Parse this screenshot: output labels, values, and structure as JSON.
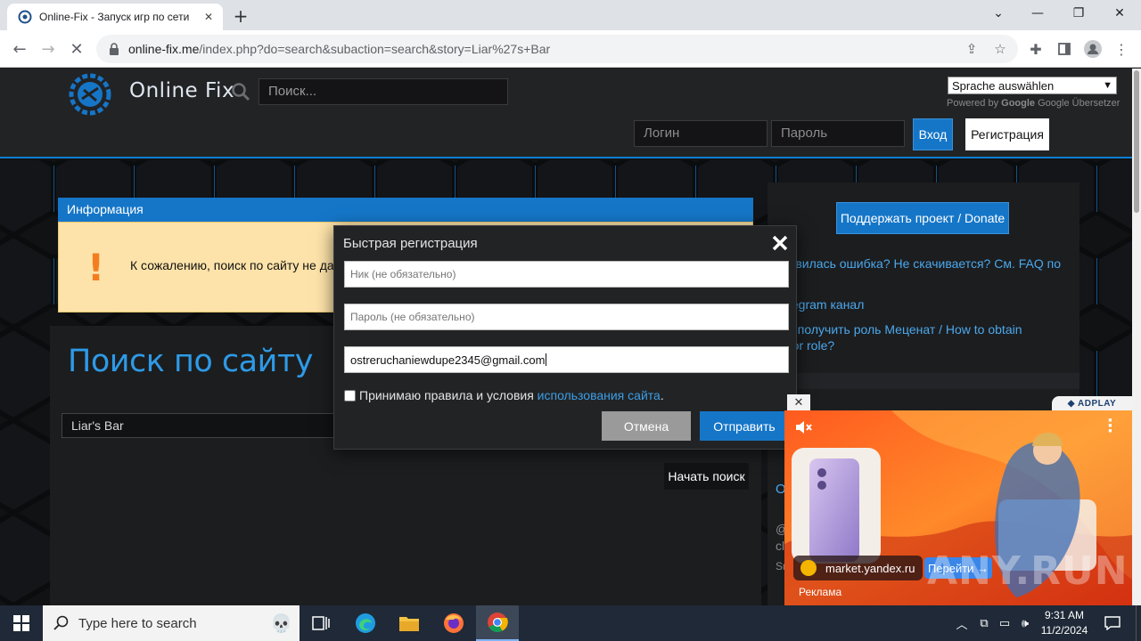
{
  "browser": {
    "tab_title": "Online-Fix - Запуск игр по сети",
    "url_host": "online-fix.me",
    "url_path": "/index.php?do=search&subaction=search&story=Liar%27s+Bar"
  },
  "header": {
    "site_name": "Online Fix",
    "search_placeholder": "Поиск...",
    "lang_select": "Sprache auswählen",
    "powered_by": "Powered by",
    "google": "Google",
    "translate": "Google Übersetzer",
    "login_placeholder": "Логин",
    "password_placeholder": "Пароль",
    "login_button": "Вход",
    "register_button": "Регистрация"
  },
  "info": {
    "heading": "Информация",
    "message": "К сожалению, поиск по сайту не дал"
  },
  "main": {
    "page_title": "Поиск по сайту",
    "search_value": "Liar's Bar",
    "search_button": "Начать поиск"
  },
  "sidebar": {
    "donate": "Поддержать проект / Donate",
    "link1_line1": "оявилась ошибка? Не скачивается? См. FAQ по",
    "link1_line2": "у",
    "link2": "elegram канал",
    "link3_line1": "ак получить роль Меценат / How to obtain",
    "link3_line2": "ator role?",
    "frag1": "О",
    "frag2": "@",
    "frag3": "cl",
    "frag4": "Sn"
  },
  "modal": {
    "title": "Быстрая регистрация",
    "nick_placeholder": "Ник (не обязательно)",
    "password_placeholder": "Пароль (не обязательно)",
    "email_value": "ostreruchaniewdupe2345@gmail.com",
    "agree_text": "Принимаю правила и условия ",
    "terms_link": "использования сайта",
    "agree_suffix": ".",
    "cancel": "Отмена",
    "submit": "Отправить"
  },
  "ad": {
    "brand": "ADPLAY",
    "domain": "market.yandex.ru",
    "go_button": "Перейти →",
    "label": "Реклама",
    "close": "✕",
    "watermark": "ANY.RUN"
  },
  "taskbar": {
    "search_placeholder": "Type here to search",
    "time": "9:31 AM",
    "date": "11/2/2024"
  }
}
